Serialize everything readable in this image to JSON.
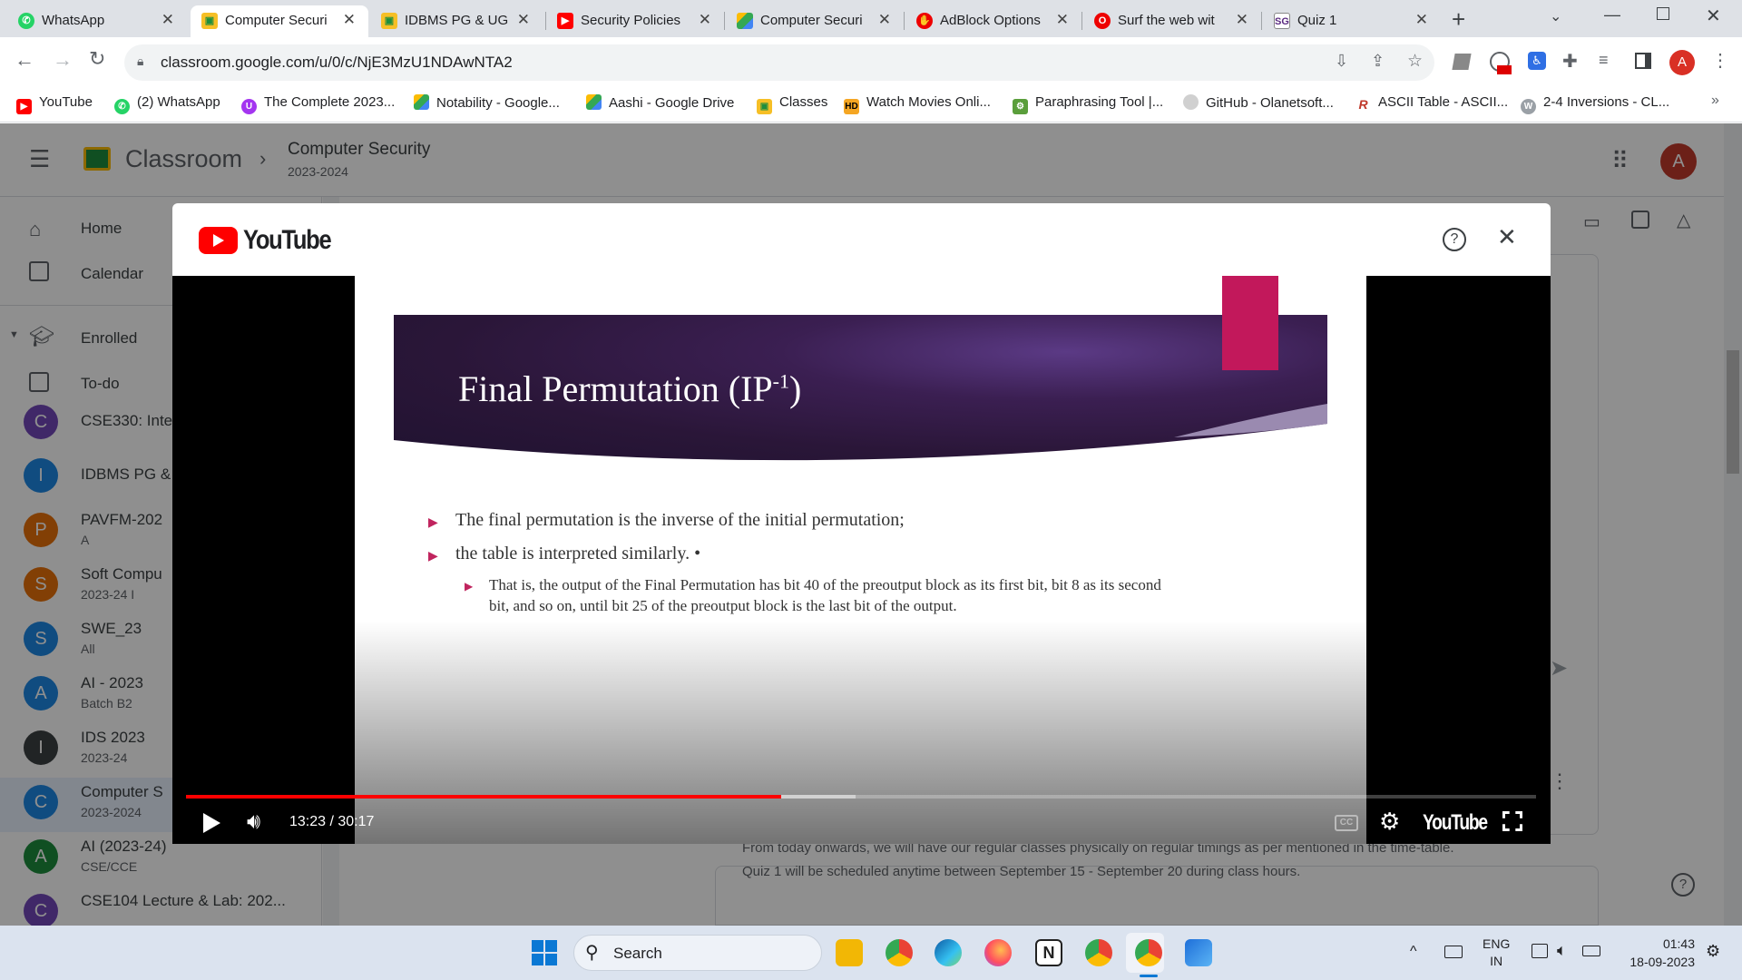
{
  "browser": {
    "tabs": [
      {
        "label": "WhatsApp",
        "icon": "whatsapp-icon",
        "active": false
      },
      {
        "label": "Computer Securi",
        "icon": "classroom-icon",
        "active": true
      },
      {
        "label": "IDBMS PG & UG",
        "icon": "classroom-icon",
        "active": false
      },
      {
        "label": "Security Policies",
        "icon": "youtube-icon",
        "active": false
      },
      {
        "label": "Computer Securi",
        "icon": "drive-icon",
        "active": false
      },
      {
        "label": "AdBlock Options",
        "icon": "adblock-icon",
        "active": false
      },
      {
        "label": "Surf the web wit",
        "icon": "opera-icon",
        "active": false
      },
      {
        "label": "Quiz 1",
        "icon": "sg-icon",
        "active": false
      }
    ],
    "url": "classroom.google.com/u/0/c/NjE3MzU1NDAwNTA2",
    "profile_initial": "A",
    "bookmarks": [
      {
        "label": "YouTube",
        "icon": "youtube-icon"
      },
      {
        "label": "(2) WhatsApp",
        "icon": "whatsapp-icon"
      },
      {
        "label": "The Complete 2023...",
        "icon": "udemy-icon"
      },
      {
        "label": "Notability - Google...",
        "icon": "drive-icon"
      },
      {
        "label": "Aashi - Google Drive",
        "icon": "drive-icon"
      },
      {
        "label": "Classes",
        "icon": "classroom-icon"
      },
      {
        "label": "Watch Movies Onli...",
        "icon": "hd-icon"
      },
      {
        "label": "Paraphrasing Tool |...",
        "icon": "robot-icon"
      },
      {
        "label": "GitHub - Olanetsoft...",
        "icon": "github-icon"
      },
      {
        "label": "ASCII Table - ASCII...",
        "icon": "r-icon"
      },
      {
        "label": "2-4 Inversions - CL...",
        "icon": "w-icon"
      }
    ],
    "more_bookmarks": "»"
  },
  "classroom": {
    "app_name": "Classroom",
    "breadcrumb_title": "Computer Security",
    "breadcrumb_sub": "2023-2024",
    "user_initial": "A",
    "nav": {
      "home": "Home",
      "calendar": "Calendar",
      "enrolled": "Enrolled",
      "todo": "To-do"
    },
    "classes": [
      {
        "initial": "C",
        "title": "CSE330: Inte",
        "sub": "",
        "color": "#7248b9"
      },
      {
        "initial": "I",
        "title": "IDBMS PG &",
        "sub": "",
        "color": "#1e88e5"
      },
      {
        "initial": "P",
        "title": "PAVFM-202",
        "sub": "A",
        "color": "#e8710a"
      },
      {
        "initial": "S",
        "title": "Soft Compu",
        "sub": "2023-24 I",
        "color": "#e8710a"
      },
      {
        "initial": "S",
        "title": "SWE_23",
        "sub": "All",
        "color": "#1e88e5"
      },
      {
        "initial": "A",
        "title": "AI - 2023",
        "sub": "Batch B2",
        "color": "#1e88e5"
      },
      {
        "initial": "I",
        "title": "IDS 2023",
        "sub": "2023-24",
        "color": "#3c4043"
      },
      {
        "initial": "C",
        "title": "Computer S",
        "sub": "2023-2024",
        "color": "#1e88e5"
      },
      {
        "initial": "A",
        "title": "AI (2023-24)",
        "sub": "CSE/CCE",
        "color": "#1e8e3e"
      },
      {
        "initial": "C",
        "title": "CSE104 Lecture & Lab: 202...",
        "sub": "",
        "color": "#7248b9"
      }
    ],
    "announcement_line1": "From today onwards, we will have our regular classes physically on regular timings as per mentioned in the time-table.",
    "announcement_line2": "Quiz 1 will be scheduled anytime between September 15 - September 20 during class hours."
  },
  "youtube_modal": {
    "brand": "YouTube",
    "slide": {
      "title_main": "Final Permutation (IP",
      "title_sup": "-1",
      "title_close": ")",
      "bullet1": "The final permutation is the inverse of the initial permutation;",
      "bullet2": "the table is interpreted similarly. •",
      "sub_bullet_line1": "That is, the output of the Final Permutation has bit 40 of the preoutput block as its first bit, bit 8 as its second",
      "sub_bullet_line2": "bit, and so on, until bit 25 of the preoutput block is the last bit of the output."
    },
    "player": {
      "time": "13:23 / 30:17",
      "progress": 0.441,
      "buffered": 0.496,
      "cc_label": "CC",
      "brand": "YouTube"
    }
  },
  "taskbar": {
    "search": "Search",
    "lang_line1": "ENG",
    "lang_line2": "IN",
    "time": "01:43",
    "date": "18-09-2023"
  },
  "colors": {
    "tab_strip": "#dee1e6",
    "youtube_red": "#ff0000",
    "progress_red": "#f00",
    "slide_accent": "#c0245e",
    "banner_pink": "#c2185b"
  }
}
